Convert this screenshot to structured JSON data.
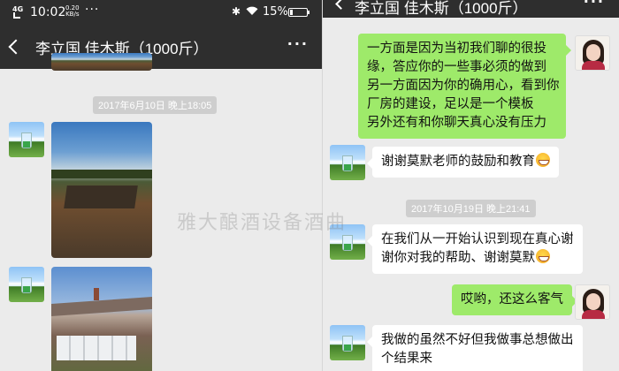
{
  "status_bar": {
    "network": "4G",
    "time": "10:02",
    "speed_value": "0.20",
    "speed_unit": "KB/s",
    "dots": "···",
    "battery_percent": "15%"
  },
  "left": {
    "header": {
      "title": "李立国 佳木斯（1000斤）",
      "more": "···"
    },
    "timestamp": "2017年6月10日 晚上18:05"
  },
  "right": {
    "header": {
      "title": "李立国 佳木斯（1000斤）",
      "more": "···"
    },
    "messages": {
      "m1": {
        "lines": [
          "一方面是因为当初我们聊的很投",
          "缘，答应你的一些事必须的做到",
          "另一方面因为你的确用心，看到你",
          "厂房的建设，足以是一个模板",
          "另外还有和你聊天真心没有压力"
        ]
      },
      "m2": {
        "text": "谢谢莫默老师的鼓励和教育"
      },
      "timestamp": "2017年10月19日 晚上21:41",
      "m3": {
        "lines": [
          "在我们从一开始认识到现在真心谢",
          "谢你对我的帮助、谢谢莫默"
        ]
      },
      "m4": {
        "text": "哎哟，还这么客气"
      },
      "m5": {
        "lines": [
          "我做的虽然不好但我做事总想做出",
          "个结果来"
        ]
      }
    }
  },
  "watermark": "雅大酿酒设备酒曲",
  "colors": {
    "header_bg": "#2e2e2e",
    "chat_bg": "#ebebeb",
    "outgoing_bubble": "#9eea6a",
    "incoming_bubble": "#ffffff",
    "timestamp_bg": "#cecece"
  },
  "icons": {
    "back": "chevron-left-icon",
    "more": "more-dots-icon",
    "bluetooth": "bluetooth-icon",
    "wifi": "wifi-icon",
    "battery": "battery-icon",
    "emoji": "grin-emoji"
  }
}
